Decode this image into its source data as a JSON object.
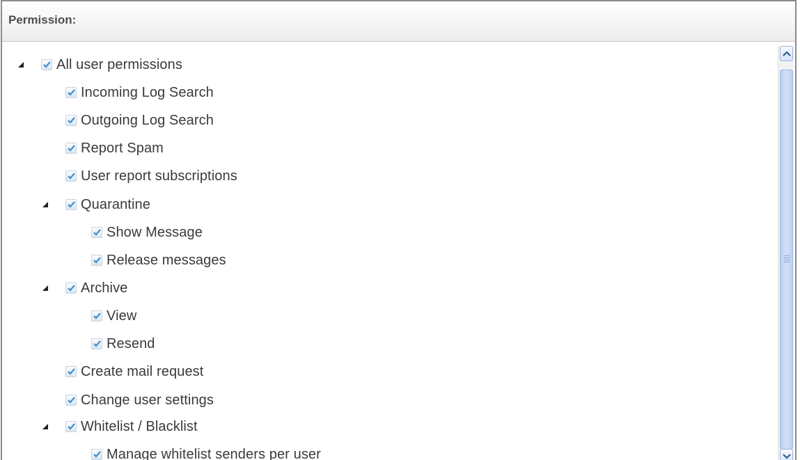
{
  "panel": {
    "title": "Permission:"
  },
  "tree": {
    "root": {
      "label": "All user permissions",
      "checked": true,
      "expanded": true
    },
    "items": [
      {
        "label": "Incoming Log Search",
        "checked": true
      },
      {
        "label": "Outgoing Log Search",
        "checked": true
      },
      {
        "label": "Report Spam",
        "checked": true
      },
      {
        "label": "User report subscriptions",
        "checked": true
      },
      {
        "label": "Quarantine",
        "checked": true,
        "expanded": true
      },
      {
        "label": "Show Message",
        "checked": true
      },
      {
        "label": "Release messages",
        "checked": true
      },
      {
        "label": "Archive",
        "checked": true,
        "expanded": true
      },
      {
        "label": "View",
        "checked": true
      },
      {
        "label": "Resend",
        "checked": true
      },
      {
        "label": "Create mail request",
        "checked": true
      },
      {
        "label": "Change user settings",
        "checked": true
      },
      {
        "label": "Whitelist / Blacklist",
        "checked": true,
        "expanded": true
      },
      {
        "label": "Manage whitelist senders per user",
        "checked": true
      }
    ]
  },
  "scrollbar": {
    "up_icon": "chevron-up-icon",
    "down_icon": "chevron-down-icon"
  },
  "colors": {
    "checkmark": "#3c8fd0",
    "thumb": "#c6d7f4",
    "header_text": "#4e4e4e"
  }
}
